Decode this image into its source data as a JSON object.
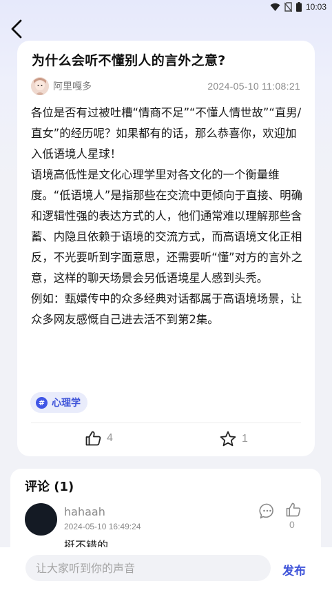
{
  "status_bar": {
    "time": "10:03",
    "icons": [
      "wifi-icon",
      "sim-off-icon",
      "battery-icon"
    ]
  },
  "nav": {
    "back_icon": "chevron-left-icon"
  },
  "post": {
    "title": "为什么会听不懂别人的言外之意?",
    "author": "阿里嘎多",
    "time": "2024-05-10 11:08:21",
    "paragraphs": [
      "各位是否有过被吐槽“情商不足”“不懂人情世故”“直男/直女”的经历呢？如果都有的话，那么恭喜你，欢迎加入低语境人星球！",
      "语境高低性是文化心理学里对各文化的一个衡量维度。“低语境人”是指那些在交流中更倾向于直接、明确和逻辑性强的表达方式的人，他们通常难以理解那些含蓄、内隐且依赖于语境的交流方式，而高语境文化正相反，不光要听到字面意思，还需要听“懂”对方的言外之意，这样的聊天场景会另低语境星人感到头秃。",
      "例如：甄嬛传中的众多经典对话都属于高语境场景，让众多网友感慨自己进去活不到第2集。"
    ],
    "tag": {
      "icon": "hashtag-icon",
      "label": "心理学"
    },
    "likes": "4",
    "favorites": "1"
  },
  "comments": {
    "title": "评论 (1)",
    "items": [
      {
        "user": "hahaah",
        "time": "2024-05-10 16:49:24",
        "text": "挺不错的",
        "likes": "0"
      }
    ]
  },
  "composer": {
    "placeholder": "让大家听到你的声音",
    "submit_label": "发布"
  },
  "colors": {
    "accent": "#3f54d9",
    "tag_bg": "#e9ecfb",
    "page_bg": "#f1f2f7"
  }
}
